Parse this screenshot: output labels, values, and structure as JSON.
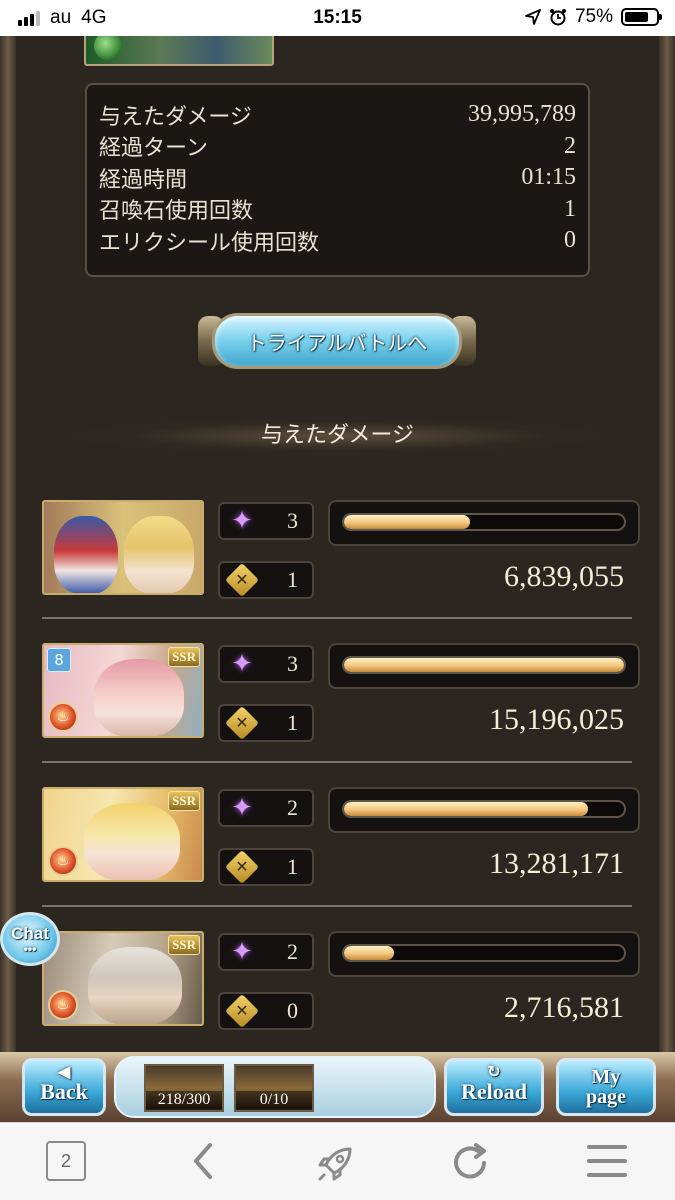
{
  "status_bar": {
    "carrier": "au",
    "network": "4G",
    "time": "15:15",
    "battery": "75%",
    "battery_level": 0.75
  },
  "stats": [
    {
      "label": "与えたダメージ",
      "value": "39,995,789"
    },
    {
      "label": "経過ターン",
      "value": "2"
    },
    {
      "label": "経過時間",
      "value": "01:15"
    },
    {
      "label": "召喚石使用回数",
      "value": "1"
    },
    {
      "label": "エリクシール使用回数",
      "value": "0"
    }
  ],
  "trial_button": {
    "label": "トライアルバトルへ"
  },
  "damage_header": "与えたダメージ",
  "members": [
    {
      "skills": "3",
      "ougi": "1",
      "damage": "6,839,055",
      "bar_fraction": 0.45,
      "badge": ""
    },
    {
      "skills": "3",
      "ougi": "1",
      "damage": "15,196,025",
      "bar_fraction": 1.0,
      "badge": "SSR"
    },
    {
      "skills": "2",
      "ougi": "1",
      "damage": "13,281,171",
      "bar_fraction": 0.87,
      "badge": "SSR"
    },
    {
      "skills": "2",
      "ougi": "0",
      "damage": "2,716,581",
      "bar_fraction": 0.18,
      "badge": "SSR"
    }
  ],
  "chat_button": {
    "label": "Chat"
  },
  "game_bar": {
    "back": "Back",
    "reload": "Reload",
    "my": "My",
    "page": "page",
    "ap": "218/300",
    "bp": "0/10"
  },
  "browser": {
    "tab_count": "2"
  },
  "colors": {
    "bar_fill": "#f2c87c",
    "panel": "#2b2620",
    "button_blue": "#3fa6cc"
  }
}
